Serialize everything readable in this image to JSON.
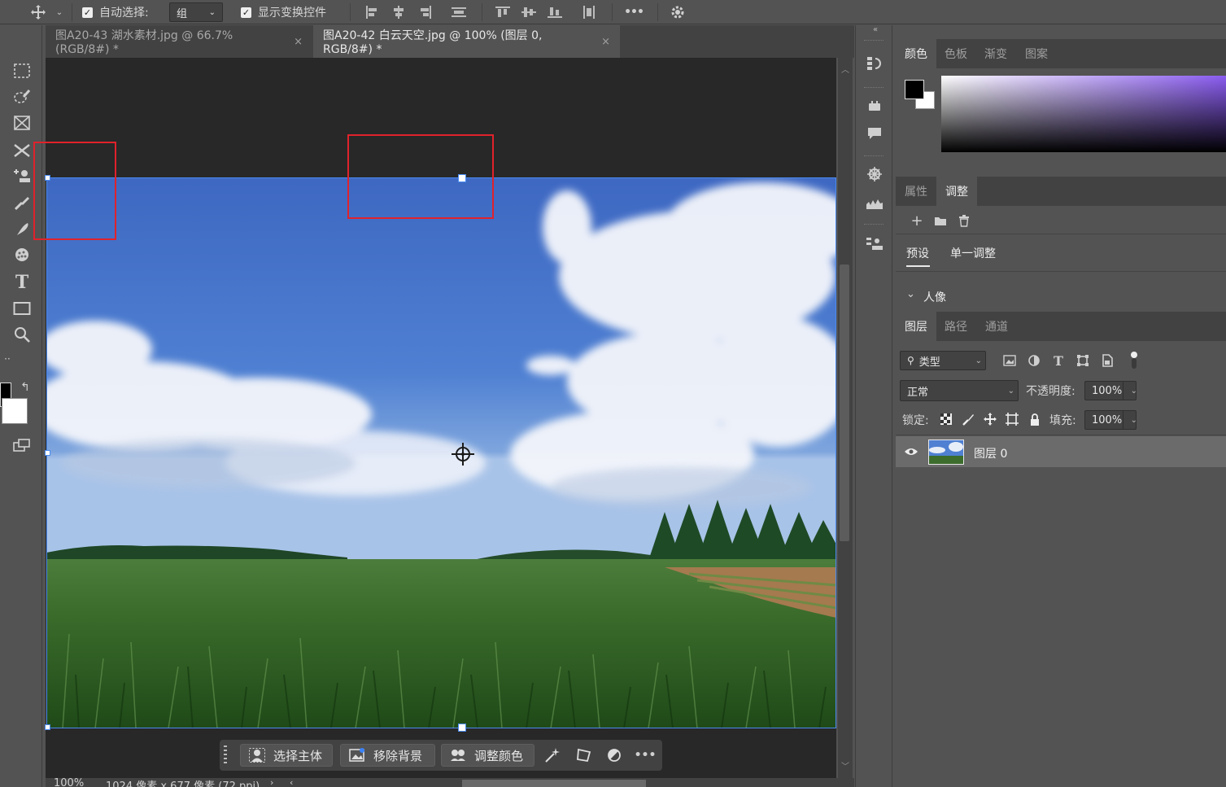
{
  "options_bar": {
    "auto_select_label": "自动选择:",
    "auto_select_value": "组",
    "show_transform_label": "显示变换控件",
    "more_label": "•••"
  },
  "tabs": [
    {
      "label": "图A20-43 湖水素材.jpg @ 66.7%(RGB/8#) *",
      "close": "×"
    },
    {
      "label": "图A20-42 白云天空.jpg @ 100% (图层 0, RGB/8#) *",
      "close": "×"
    }
  ],
  "panels": {
    "color_tabs": [
      "颜色",
      "色板",
      "渐变",
      "图案"
    ],
    "adjust_tabs": [
      "属性",
      "调整"
    ],
    "adjust_subtabs": [
      "预设",
      "单一调整"
    ],
    "adjust_group": "人像",
    "layer_tabs": [
      "图层",
      "路径",
      "通道"
    ],
    "filter_kind": "类型",
    "blend_mode": "正常",
    "opacity_label": "不透明度:",
    "opacity_value": "100%",
    "lock_label": "锁定:",
    "fill_label": "填充:",
    "fill_value": "100%",
    "layer_name": "图层 0"
  },
  "taskbar": {
    "select_subject": "选择主体",
    "remove_bg": "移除背景",
    "adjust_color": "调整颜色",
    "more": "•••"
  },
  "status": {
    "zoom": "100%",
    "doc_info": "1024 像素 x 677 像素 (72 ppi)"
  },
  "colors": {
    "accent_red": "#e0222c",
    "selection_blue": "#4a8af0"
  }
}
